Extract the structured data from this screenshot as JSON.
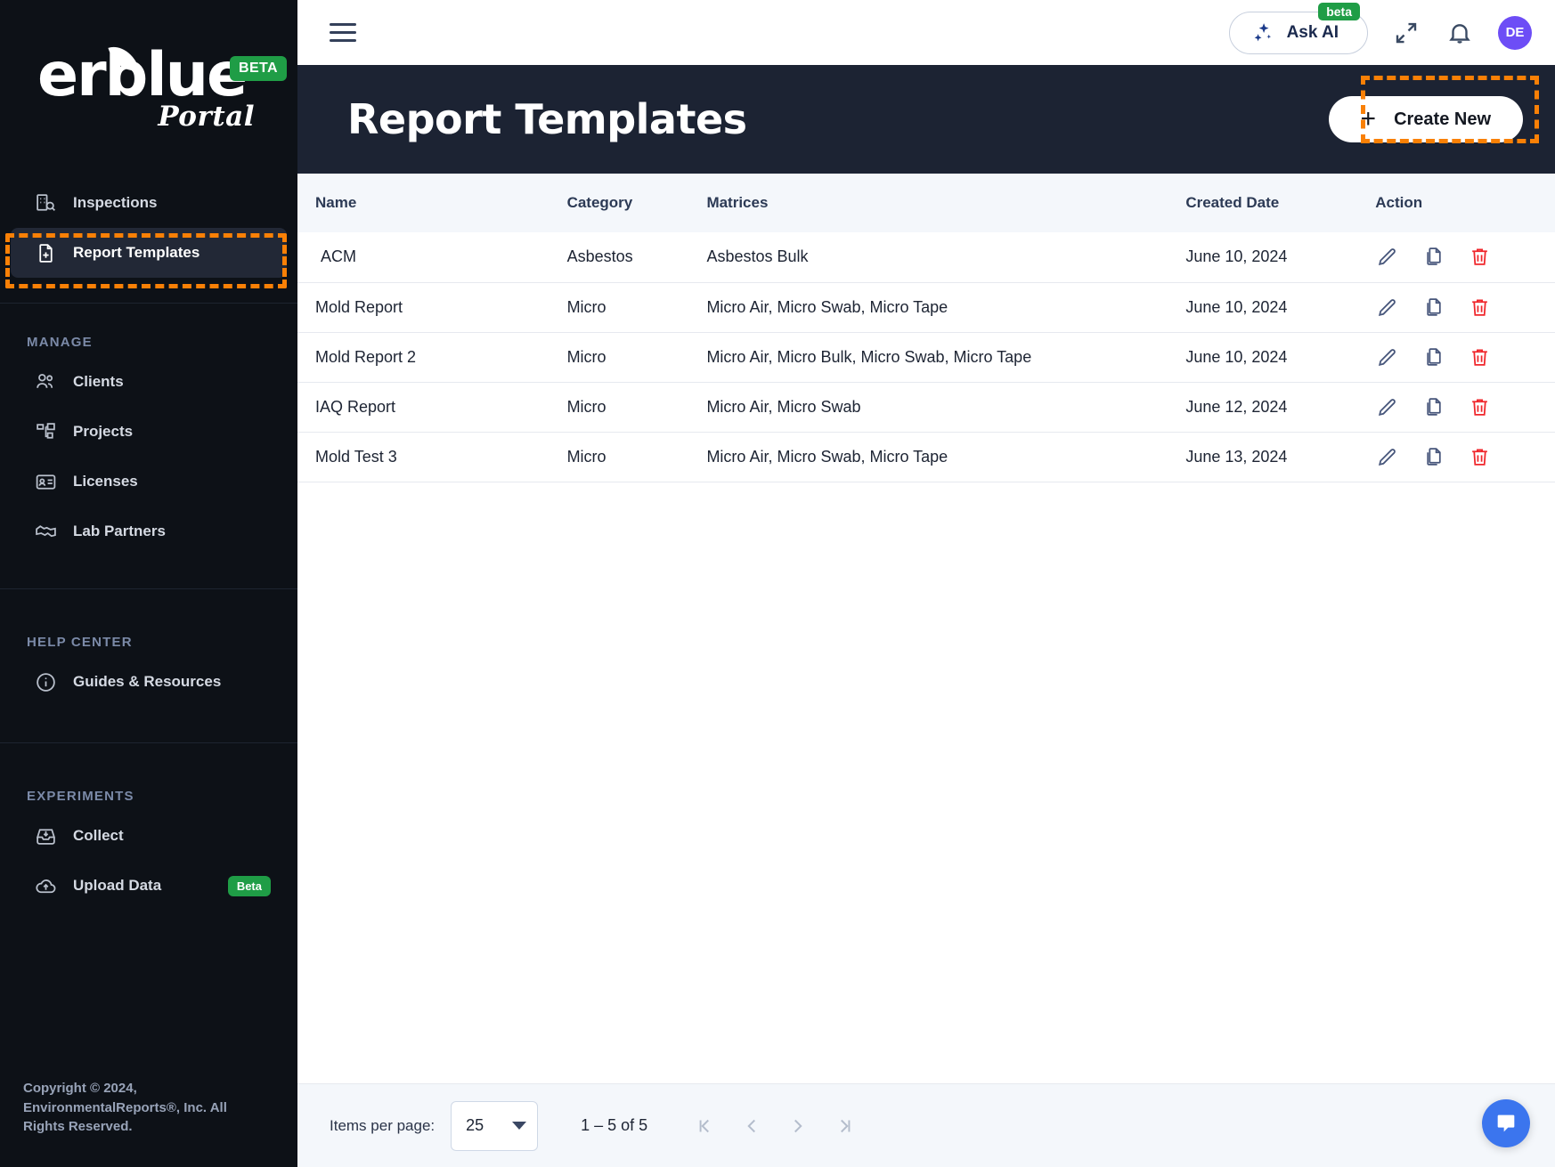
{
  "brand": {
    "logo_text": "erblue",
    "logo_sub": "Portal",
    "beta_badge": "BETA"
  },
  "sidebar": {
    "primary_items": [
      {
        "label": "Inspections",
        "icon": "building-search-icon",
        "active": false
      },
      {
        "label": "Report Templates",
        "icon": "file-plus-icon",
        "active": true
      }
    ],
    "manage_label": "MANAGE",
    "manage_items": [
      {
        "label": "Clients",
        "icon": "users-icon"
      },
      {
        "label": "Projects",
        "icon": "sitemap-icon"
      },
      {
        "label": "Licenses",
        "icon": "id-card-icon"
      },
      {
        "label": "Lab Partners",
        "icon": "handshake-icon"
      }
    ],
    "help_label": "HELP CENTER",
    "help_items": [
      {
        "label": "Guides & Resources",
        "icon": "info-circle-icon"
      }
    ],
    "experiments_label": "EXPERIMENTS",
    "experiments_items": [
      {
        "label": "Collect",
        "icon": "inbox-download-icon",
        "badge": ""
      },
      {
        "label": "Upload Data",
        "icon": "cloud-upload-icon",
        "badge": "Beta"
      }
    ],
    "copyright": "Copyright © 2024, EnvironmentalReports®, Inc. All Rights Reserved."
  },
  "topbar": {
    "menu_icon": "hamburger-icon",
    "ask_ai_label": "Ask AI",
    "ask_ai_badge": "beta",
    "fullscreen_icon": "expand-icon",
    "notifications_icon": "bell-icon",
    "avatar_initials": "DE"
  },
  "page": {
    "title": "Report Templates",
    "create_button_label": "Create New"
  },
  "table": {
    "columns": [
      "Name",
      "Category",
      "Matrices",
      "Created Date",
      "Action"
    ],
    "rows": [
      {
        "name": "ACM",
        "category": "Asbestos",
        "matrices": "Asbestos Bulk",
        "created": "June 10, 2024"
      },
      {
        "name": "Mold Report",
        "category": "Micro",
        "matrices": "Micro Air, Micro Swab, Micro Tape",
        "created": "June 10, 2024"
      },
      {
        "name": "Mold Report 2",
        "category": "Micro",
        "matrices": "Micro Air, Micro Bulk, Micro Swab, Micro Tape",
        "created": "June 10, 2024"
      },
      {
        "name": "IAQ Report",
        "category": "Micro",
        "matrices": "Micro Air, Micro Swab",
        "created": "June 12, 2024"
      },
      {
        "name": "Mold Test 3",
        "category": "Micro",
        "matrices": "Micro Air, Micro Swab, Micro Tape",
        "created": "June 13, 2024"
      }
    ],
    "row_actions": [
      "edit-icon",
      "duplicate-icon",
      "delete-icon"
    ]
  },
  "paginator": {
    "items_per_page_label": "Items per page:",
    "items_per_page_value": "25",
    "range_label": "1 – 5 of 5",
    "first_page_icon": "first-page-icon",
    "prev_page_icon": "prev-page-icon",
    "next_page_icon": "next-page-icon",
    "last_page_icon": "last-page-icon"
  },
  "chat": {
    "icon": "chat-bubble-icon"
  },
  "colors": {
    "sidebar_bg": "#0d1117",
    "page_head_bg": "#1c2333",
    "highlight": "#f98006",
    "badge_green": "#1f9d46",
    "avatar_purple": "#6d4df6",
    "delete_red": "#f0262b",
    "chat_blue": "#3b75ee"
  }
}
